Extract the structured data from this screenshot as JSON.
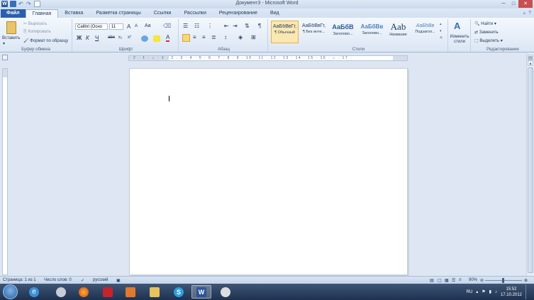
{
  "window": {
    "title": "Документ3 - Microsoft Word",
    "quick_access": [
      "word-logo",
      "save-icon",
      "undo-icon",
      "redo-icon",
      "new-doc-icon"
    ],
    "word_logo_letter": "W"
  },
  "tabs": [
    "Файл",
    "Главная",
    "Вставка",
    "Разметка страницы",
    "Ссылки",
    "Рассылки",
    "Рецензирование",
    "Вид"
  ],
  "active_tab": "Главная",
  "ribbon": {
    "clipboard": {
      "paste": "Вставить",
      "cut": "Вырезать",
      "copy": "Копировать",
      "format_painter": "Формат по образцу",
      "label": "Буфер обмена"
    },
    "font": {
      "font_name": "Calibri (Осно",
      "font_size": "11",
      "label": "Шрифт",
      "bold": "Ж",
      "italic": "К",
      "underline": "Ч",
      "strike": "abe",
      "subscript": "x₂",
      "superscript": "x²",
      "grow": "A",
      "shrink": "A",
      "case": "Aa",
      "text_color_glyph": "A"
    },
    "paragraph": {
      "label": "Абзац",
      "show_marks": "¶"
    },
    "styles": {
      "label": "Стили",
      "items": [
        {
          "sample": "АаБбВвГг,",
          "name": "¶ Обычный"
        },
        {
          "sample": "АаБбВвГг,",
          "name": "¶ Без инте..."
        },
        {
          "sample": "АаБбВ",
          "name": "Заголово..."
        },
        {
          "sample": "АаБбВв",
          "name": "Заголово..."
        },
        {
          "sample": "Aab",
          "name": "Название"
        },
        {
          "sample": "АаБбВв",
          "name": "Подзагол..."
        }
      ],
      "change_styles": "Изменить стили"
    },
    "editing": {
      "label": "Редактирование",
      "find": "Найти",
      "replace": "Заменить",
      "select": "Выделить"
    }
  },
  "ruler": {
    "marks": "· 2 · 1 · ⌂ · 1 · 2 · 3 · 4 · 5 · 6 · 7 · 8 · 9 · 10 · 11 · 12 · 13 · 14 · 15 · 16 · ⌂ · 17 ·"
  },
  "statusbar": {
    "page": "Страница: 1 из 1",
    "words": "Число слов: 0",
    "language": "русский",
    "zoom": "90%"
  },
  "taskbar": {
    "apps": [
      "explorer-icon",
      "ie-icon",
      "firefox-icon",
      "acrobat-icon",
      "media-player-icon",
      "folder-icon",
      "skype-icon",
      "word-icon",
      "media-icon"
    ],
    "active_app": "word-icon",
    "lang": "RU",
    "time": "15:52",
    "date": "17.10.2012"
  }
}
